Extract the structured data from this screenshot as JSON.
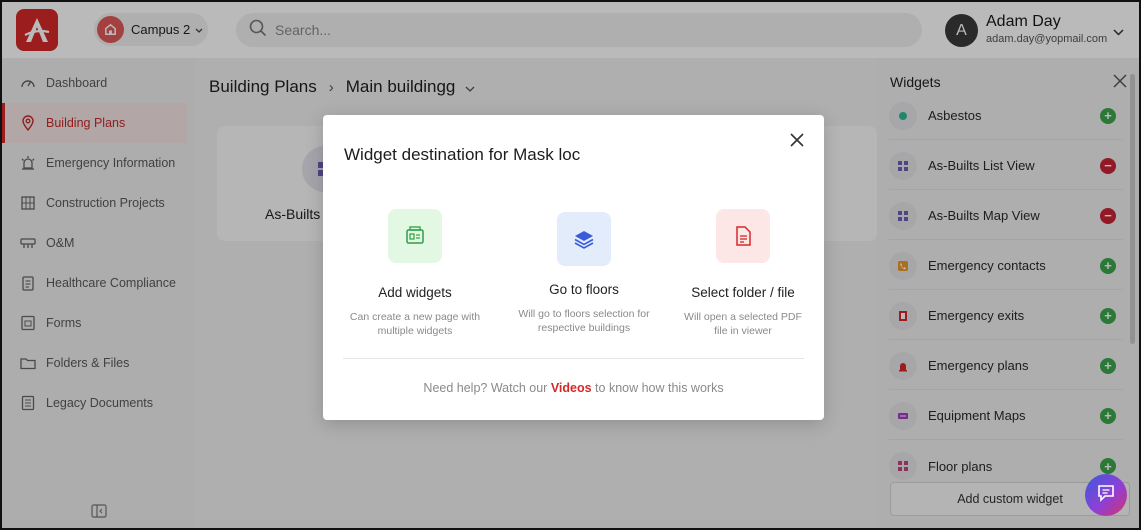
{
  "topbar": {
    "campus_label": "Campus 2",
    "search_placeholder": "Search...",
    "user_name": "Adam Day",
    "user_email": "adam.day@yopmail.com",
    "avatar_initial": "A"
  },
  "sidebar": {
    "items": [
      {
        "label": "Dashboard",
        "icon": "gauge-icon"
      },
      {
        "label": "Building Plans",
        "icon": "location-pin-icon",
        "active": true
      },
      {
        "label": "Emergency Information",
        "icon": "siren-icon"
      },
      {
        "label": "Construction Projects",
        "icon": "building-icon"
      },
      {
        "label": "O&M",
        "icon": "tools-icon"
      },
      {
        "label": "Healthcare Compliance",
        "icon": "clipboard-icon"
      },
      {
        "label": "Forms",
        "icon": "form-icon"
      },
      {
        "label": "Folders & Files",
        "icon": "folder-icon"
      },
      {
        "label": "Legacy Documents",
        "icon": "document-icon"
      }
    ]
  },
  "main": {
    "breadcrumb": [
      "Building Plans",
      "Main buildingg"
    ],
    "card_label": "As-Builts"
  },
  "widgets_panel": {
    "title": "Widgets",
    "items": [
      {
        "label": "Asbestos",
        "action": "add"
      },
      {
        "label": "As-Builts List View",
        "action": "remove"
      },
      {
        "label": "As-Builts Map View",
        "action": "remove"
      },
      {
        "label": "Emergency contacts",
        "action": "add"
      },
      {
        "label": "Emergency exits",
        "action": "add"
      },
      {
        "label": "Emergency plans",
        "action": "add"
      },
      {
        "label": "Equipment Maps",
        "action": "add"
      },
      {
        "label": "Floor plans",
        "action": "add"
      }
    ],
    "custom_button": "Add custom widget"
  },
  "modal": {
    "title": "Widget destination for Mask loc",
    "options": [
      {
        "title": "Add widgets",
        "desc": "Can create a new page with multiple widgets",
        "color": "#e3f8e3"
      },
      {
        "title": "Go to floors",
        "desc": "Will go to floors selection for respective buildings",
        "color": "#e3ecfb"
      },
      {
        "title": "Select folder / file",
        "desc": "Will open a selected PDF file in viewer",
        "color": "#fde6e6"
      }
    ],
    "help_prefix": "Need help? Watch our ",
    "help_link": "Videos",
    "help_suffix": " to know how this works"
  },
  "colors": {
    "brand": "#d62828",
    "add": "#3aa64b",
    "remove": "#c82333"
  }
}
